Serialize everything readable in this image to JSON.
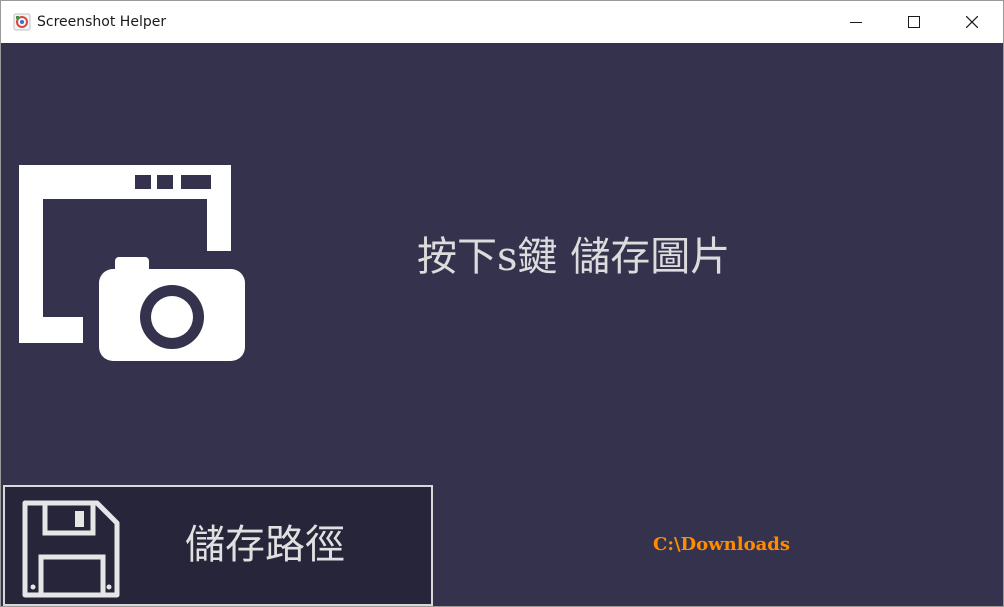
{
  "window": {
    "title": "Screenshot Helper",
    "app_icon": "app-logo-icon",
    "controls": {
      "minimize_icon": "minimize-icon",
      "maximize_icon": "maximize-icon",
      "close_icon": "close-icon"
    }
  },
  "main": {
    "hero_icon": "screenshot-camera-icon",
    "hint": "按下s鍵 儲存圖片",
    "save_path_button": {
      "label": "儲存路徑",
      "icon": "floppy-disk-icon"
    },
    "current_path": "C:\\Downloads"
  },
  "colors": {
    "background": "#34324c",
    "button_background": "#26253a",
    "path_text": "#ff8c00",
    "hint_text": "#dcdcdc"
  }
}
